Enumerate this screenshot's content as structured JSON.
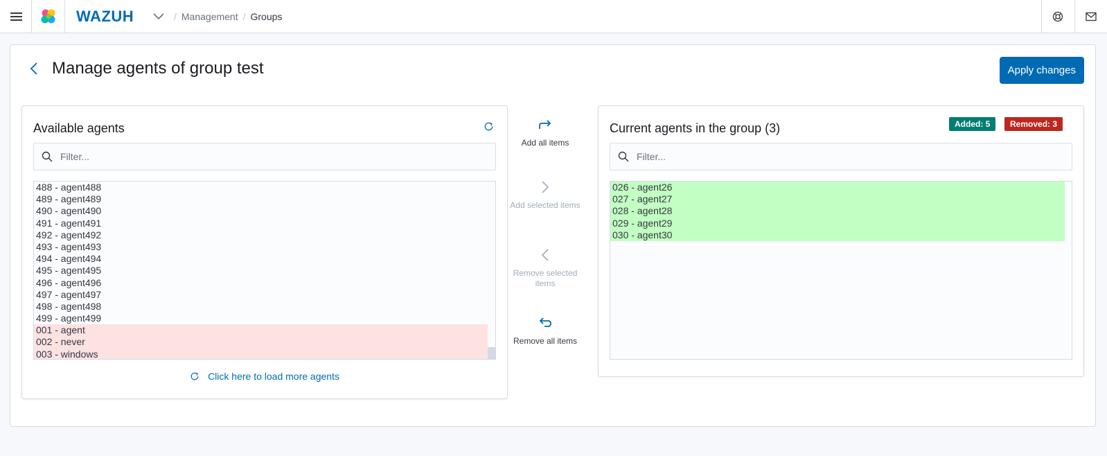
{
  "header": {
    "brand": "WAZUH",
    "breadcrumbs": [
      "Management",
      "Groups"
    ],
    "separator": "/"
  },
  "page": {
    "title": "Manage agents of group test",
    "apply_label": "Apply changes"
  },
  "available": {
    "title": "Available agents",
    "filter_placeholder": "Filter...",
    "items": [
      "488 - agent488",
      "489 - agent489",
      "490 - agent490",
      "491 - agent491",
      "492 - agent492",
      "493 - agent493",
      "494 - agent494",
      "495 - agent495",
      "496 - agent496",
      "497 - agent497",
      "498 - agent498",
      "499 - agent499"
    ],
    "removed_items": [
      "001 - agent",
      "002 - never",
      "003 - windows"
    ],
    "load_more_label": "Click here to load more agents"
  },
  "actions": {
    "add_all": "Add all items",
    "add_selected": "Add selected items",
    "remove_selected": "Remove selected items",
    "remove_all": "Remove all items"
  },
  "current": {
    "title": "Current agents in the group (3)",
    "filter_placeholder": "Filter...",
    "badge_added": "Added: 5",
    "badge_removed": "Removed: 3",
    "added_items": [
      "026 - agent26",
      "027 - agent27",
      "028 - agent28",
      "029 - agent29",
      "030 - agent30"
    ]
  },
  "colors": {
    "accent": "#006bb4",
    "added_bg": "#c2ffc2",
    "removed_bg": "#fde2e2",
    "badge_added": "#017d73",
    "badge_removed": "#bd271e"
  },
  "icons": {
    "menu": "hamburger-menu-icon",
    "logo": "app-logo-icon",
    "help": "help-lifebuoy-icon",
    "mail": "mail-icon",
    "back": "chevron-left-icon",
    "refresh": "refresh-icon",
    "search": "search-icon"
  }
}
